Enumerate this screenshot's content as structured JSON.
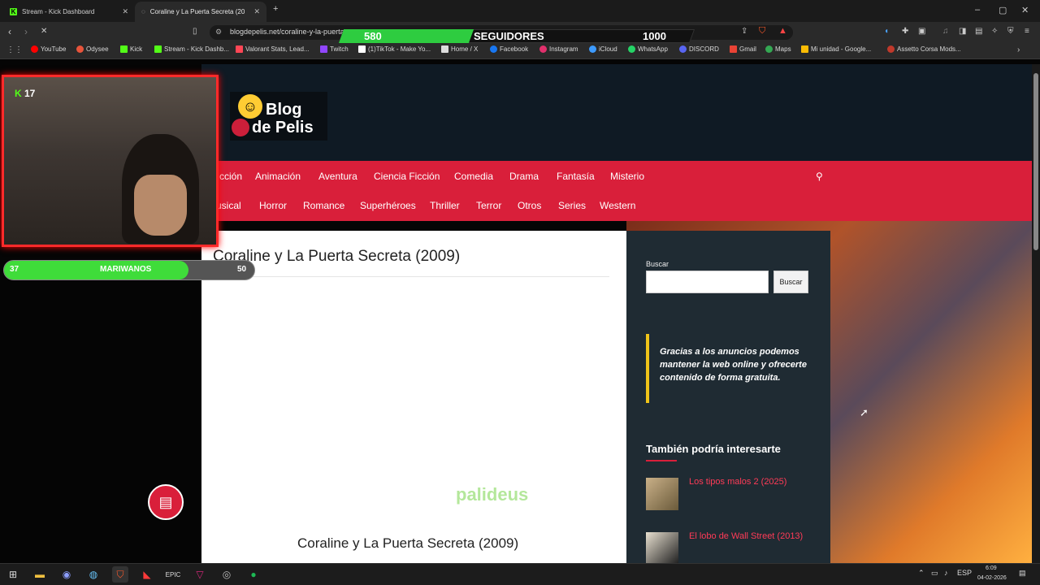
{
  "tabs": [
    {
      "label": "Stream - Kick Dashboard"
    },
    {
      "label": "Coraline y La Puerta Secreta (20"
    }
  ],
  "address": {
    "url": "blogdepelis.net/coraline-y-la-puerta"
  },
  "followers": {
    "current": "580",
    "label": "SEGUIDORES",
    "goal": "1000",
    "fraction": 0.58
  },
  "bookmarks": [
    "YouTube",
    "Odysee",
    "Kick",
    "Stream - Kick Dashb...",
    "Valorant Stats, Lead...",
    "Twitch",
    "(1)TikTok - Make Yo...",
    "Home / X",
    "Facebook",
    "Instagram",
    "iCloud",
    "WhatsApp",
    "DISCORD",
    "Gmail",
    "Maps",
    "Mi unidad - Google...",
    "Assetto Corsa Mods..."
  ],
  "site": {
    "logo_line1": "Blog",
    "logo_line2": "de Pelis",
    "nav_row1": [
      "cción",
      "Animación",
      "Aventura",
      "Ciencia Ficción",
      "Comedia",
      "Drama",
      "Fantasía",
      "Misterio"
    ],
    "nav_row2": [
      "usical",
      "Horror",
      "Romance",
      "Superhéroes",
      "Thriller",
      "Terror",
      "Otros",
      "Series",
      "Western"
    ],
    "article_title": "Coraline y La Puerta Secreta (2009)",
    "article_subtitle": "Coraline y La Puerta Secreta (2009)",
    "search_label": "Buscar",
    "search_button": "Buscar",
    "ad_notice": "Gracias a los anuncios podemos mantener la web online y ofrecerte contenido de forma gratuita.",
    "related_heading": "También podría interesarte",
    "related": [
      {
        "title": "Los tipos malos 2 (2025)"
      },
      {
        "title": "El lobo de Wall Street (2013)"
      }
    ]
  },
  "stream": {
    "viewers": "17",
    "watermark": "palideus",
    "goal_current": "37",
    "goal_label": "MARIWANOS",
    "goal_target": "50",
    "goal_fraction": 0.74
  },
  "tray": {
    "lang": "ESP",
    "time": "6:09",
    "date": "04-02-2026"
  },
  "colors": {
    "accent": "#d91f3a",
    "kick_green": "#53fc18",
    "ad_border": "#f0c419"
  }
}
